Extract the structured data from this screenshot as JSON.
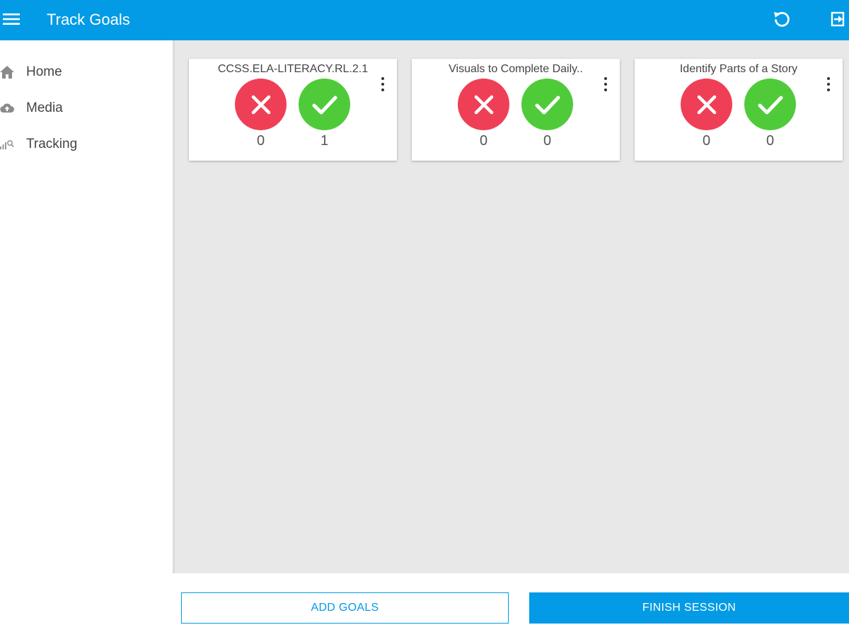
{
  "appbar": {
    "title": "Track Goals",
    "menu_icon": "hamburger-menu-icon",
    "undo_icon": "undo-icon",
    "exit_icon": "exit-icon",
    "color": "#039be5"
  },
  "sidebar": {
    "items": [
      {
        "label": "Home",
        "icon": "home-icon"
      },
      {
        "label": "Media",
        "icon": "cloud-upload-icon"
      },
      {
        "label": "Tracking",
        "icon": "tracking-chart-icon"
      }
    ]
  },
  "goals": [
    {
      "title": "CCSS.ELA-LITERACY.RL.2.1",
      "incorrect_count": "0",
      "correct_count": "1"
    },
    {
      "title": "Visuals to Complete Daily..",
      "incorrect_count": "0",
      "correct_count": "0"
    },
    {
      "title": "Identify Parts of a Story",
      "incorrect_count": "0",
      "correct_count": "0"
    }
  ],
  "colors": {
    "incorrect": "#ef3f56",
    "correct": "#4fcb3a",
    "content_bg": "#e8e8e8"
  },
  "footer": {
    "add_goals_label": "ADD GOALS",
    "finish_session_label": "FINISH SESSION"
  }
}
